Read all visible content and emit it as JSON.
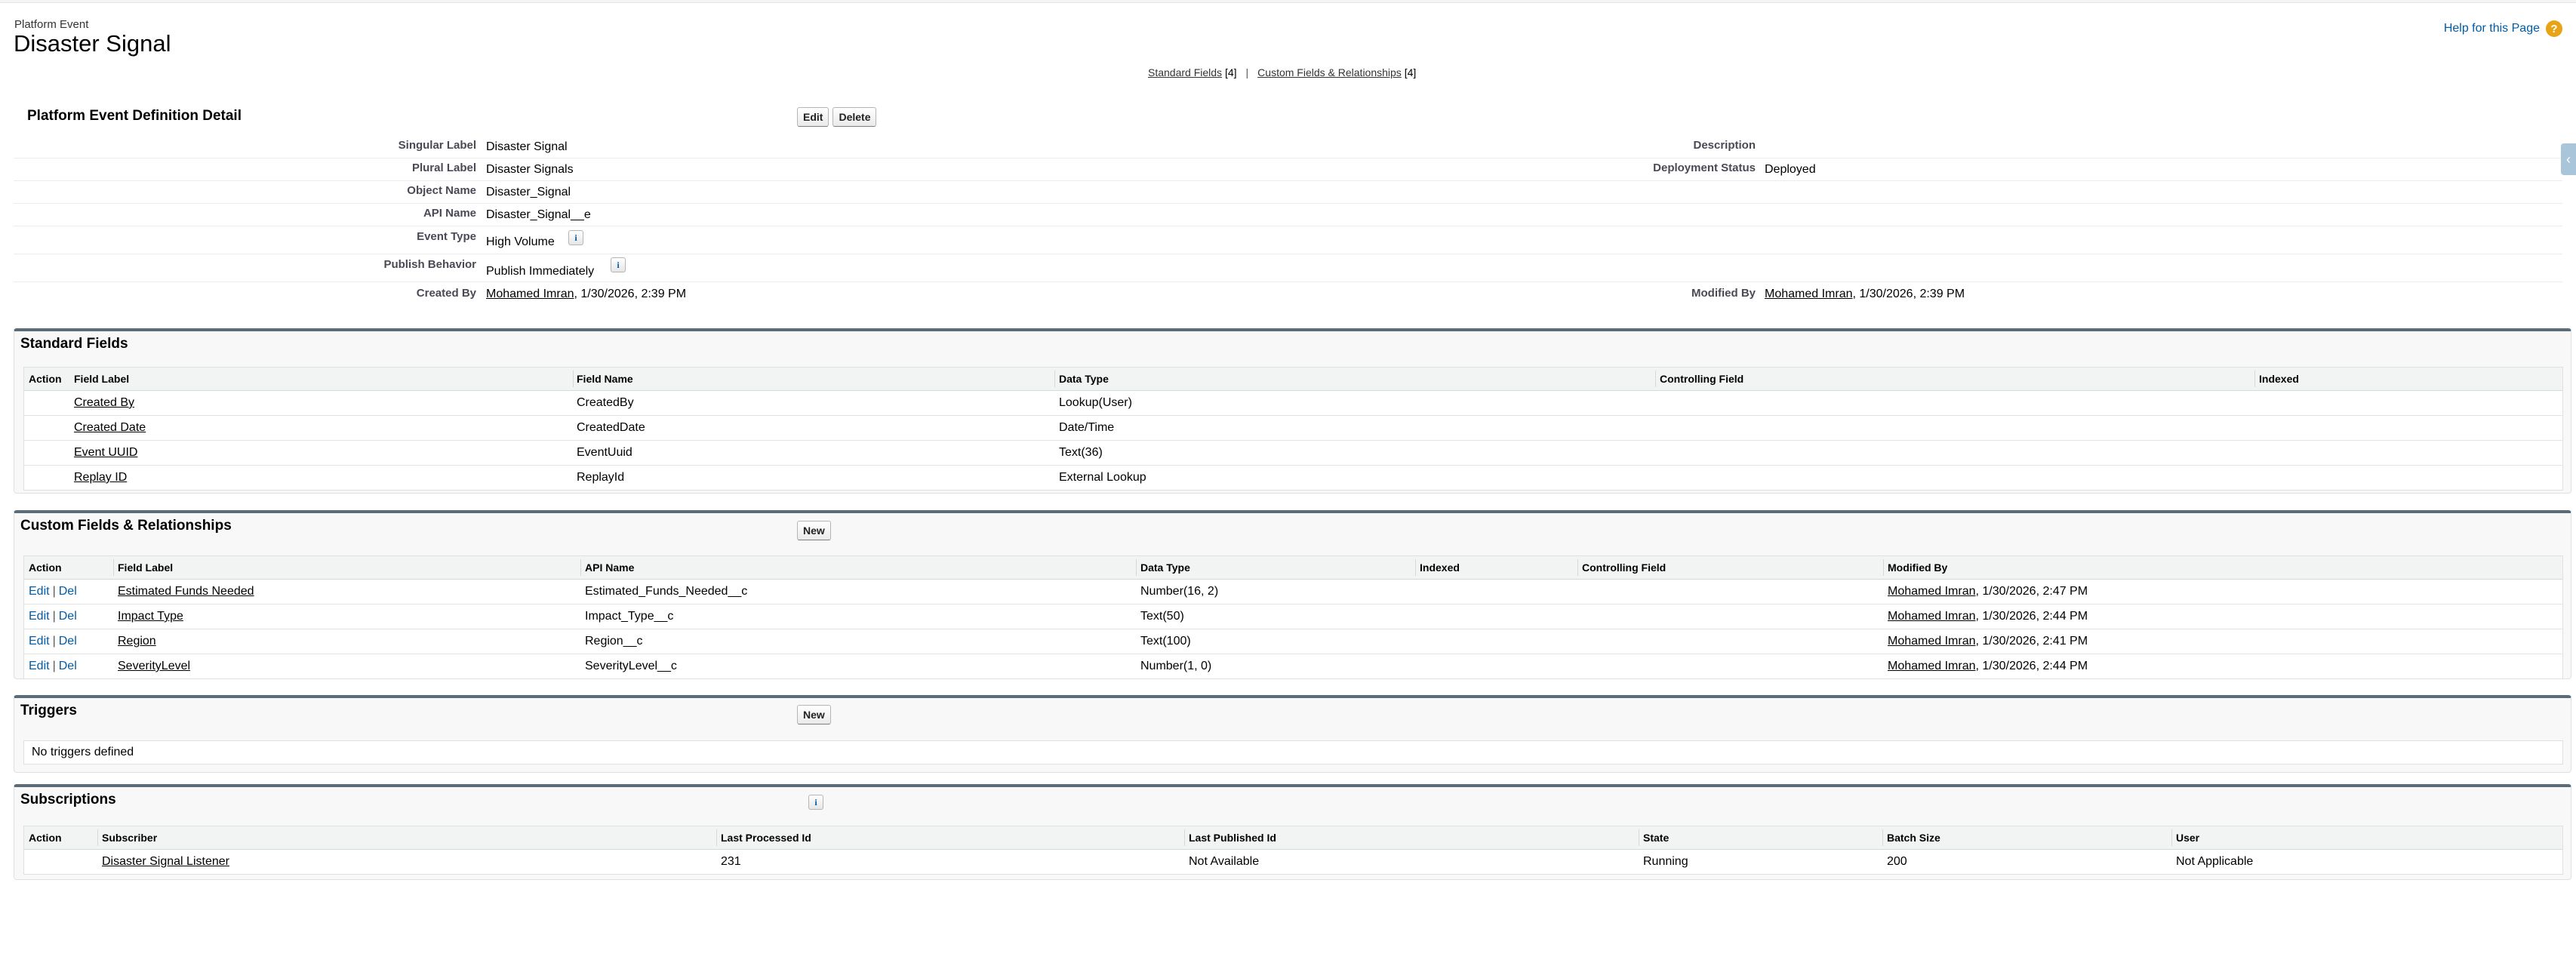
{
  "header": {
    "object_type": "Platform Event",
    "title": "Disaster Signal",
    "help_link": "Help for this Page",
    "help_icon": "question-icon",
    "related_links": [
      {
        "label": "Standard Fields",
        "count": "[4]"
      },
      {
        "label": "Custom Fields & Relationships",
        "count": "[4]"
      }
    ],
    "related_sep": "|"
  },
  "detail": {
    "heading": "Platform Event Definition Detail",
    "edit_label": "Edit",
    "delete_label": "Delete",
    "singular_label_lbl": "Singular Label",
    "singular_label_val": "Disaster Signal",
    "plural_label_lbl": "Plural Label",
    "plural_label_val": "Disaster Signals",
    "object_name_lbl": "Object Name",
    "object_name_val": "Disaster_Signal",
    "api_name_lbl": "API Name",
    "api_name_val": "Disaster_Signal__e",
    "event_type_lbl": "Event Type",
    "event_type_val": "High Volume",
    "publish_behavior_lbl": "Publish Behavior",
    "publish_behavior_val": "Publish Immediately",
    "created_by_lbl": "Created By",
    "created_by_user": "Mohamed Imran",
    "created_by_date": ", 1/30/2026, 2:39 PM",
    "description_lbl": "Description",
    "description_val": "",
    "deployment_status_lbl": "Deployment Status",
    "deployment_status_val": "Deployed",
    "modified_by_lbl": "Modified By",
    "modified_by_user": "Mohamed Imran",
    "modified_by_date": ", 1/30/2026, 2:39 PM",
    "info_glyph": "i"
  },
  "standard_fields": {
    "title": "Standard Fields",
    "columns": [
      "Action",
      "Field Label",
      "Field Name",
      "Data Type",
      "Controlling Field",
      "Indexed"
    ],
    "rows": [
      {
        "label": "Created By",
        "name": "CreatedBy",
        "type": "Lookup(User)"
      },
      {
        "label": "Created Date",
        "name": "CreatedDate",
        "type": "Date/Time"
      },
      {
        "label": "Event UUID",
        "name": "EventUuid",
        "type": "Text(36)"
      },
      {
        "label": "Replay ID",
        "name": "ReplayId",
        "type": "External Lookup"
      }
    ]
  },
  "custom_fields": {
    "title": "Custom Fields & Relationships",
    "new_label": "New",
    "edit_label": "Edit",
    "del_label": "Del",
    "sep": "|",
    "columns": [
      "Action",
      "Field Label",
      "API Name",
      "Data Type",
      "Indexed",
      "Controlling Field",
      "Modified By"
    ],
    "rows": [
      {
        "label": "Estimated Funds Needed",
        "api": "Estimated_Funds_Needed__c",
        "type": "Number(16, 2)",
        "user": "Mohamed Imran",
        "date": ", 1/30/2026, 2:47 PM"
      },
      {
        "label": "Impact Type",
        "api": "Impact_Type__c",
        "type": "Text(50)",
        "user": "Mohamed Imran",
        "date": ", 1/30/2026, 2:44 PM"
      },
      {
        "label": "Region",
        "api": "Region__c",
        "type": "Text(100)",
        "user": "Mohamed Imran",
        "date": ", 1/30/2026, 2:41 PM"
      },
      {
        "label": "SeverityLevel",
        "api": "SeverityLevel__c",
        "type": "Number(1, 0)",
        "user": "Mohamed Imran",
        "date": ", 1/30/2026, 2:44 PM"
      }
    ]
  },
  "triggers": {
    "title": "Triggers",
    "new_label": "New",
    "empty_text": "No triggers defined"
  },
  "subscriptions": {
    "title": "Subscriptions",
    "columns": [
      "Action",
      "Subscriber",
      "Last Processed Id",
      "Last Published Id",
      "State",
      "Batch Size",
      "User"
    ],
    "rows": [
      {
        "subscriber": "Disaster Signal Listener",
        "last_processed": "231",
        "last_published": "Not Available",
        "state": "Running",
        "batch": "200",
        "user": "Not Applicable"
      }
    ]
  },
  "colors": {
    "link": "#015ba7",
    "section_border": "#5a6c7a",
    "help_icon": "#e8a317"
  }
}
